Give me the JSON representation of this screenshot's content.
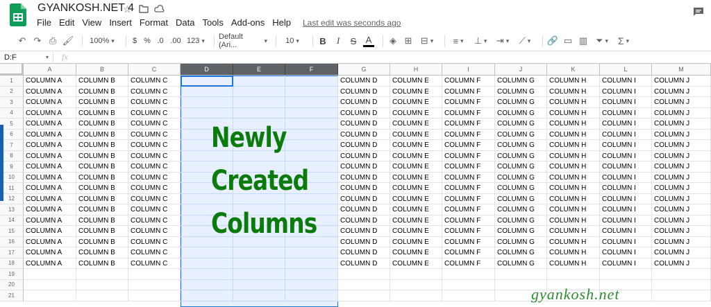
{
  "header": {
    "title": "GYANKOSH.NET 4",
    "menu": [
      "File",
      "Edit",
      "View",
      "Insert",
      "Format",
      "Data",
      "Tools",
      "Add-ons",
      "Help"
    ],
    "last_edit": "Last edit was seconds ago"
  },
  "toolbar": {
    "zoom": "100%",
    "currency": "$",
    "percent": "%",
    "dec_less": ".0",
    "dec_more": ".00",
    "format_more": "123",
    "font": "Default (Ari...",
    "font_size": "10",
    "bold": "B",
    "italic": "I",
    "strike": "S",
    "text_color": "A",
    "function": "Σ"
  },
  "formula_bar": {
    "name_box": "D:F",
    "fx": "fx"
  },
  "columns": [
    "A",
    "B",
    "C",
    "D",
    "E",
    "F",
    "G",
    "H",
    "I",
    "J",
    "K",
    "L",
    "M"
  ],
  "selected_columns": [
    "D",
    "E",
    "F"
  ],
  "row_numbers": [
    "1",
    "2",
    "3",
    "4",
    "5",
    "6",
    "7",
    "8",
    "9",
    "10",
    "11",
    "12",
    "13",
    "14",
    "15",
    "16",
    "17",
    "18",
    "19",
    "20",
    "21"
  ],
  "data_rows": 18,
  "cell_values": {
    "A": "COLUMN A",
    "B": "COLUMN B",
    "C": "COLUMN C",
    "G": "COLUMN D",
    "H": "COLUMN E",
    "I": "COLUMN F",
    "J": "COLUMN G",
    "K": "COLUMN H",
    "L": "COLUMN I",
    "M": "COLUMN J"
  },
  "annotation": [
    "Newly",
    "Created",
    "Columns"
  ],
  "watermark": "gyankosh.net",
  "colors": {
    "selection": "#e8f0fe",
    "selection_border": "#1a73e8",
    "annotation": "#0b7c0b",
    "logo": "#0f9d58"
  }
}
